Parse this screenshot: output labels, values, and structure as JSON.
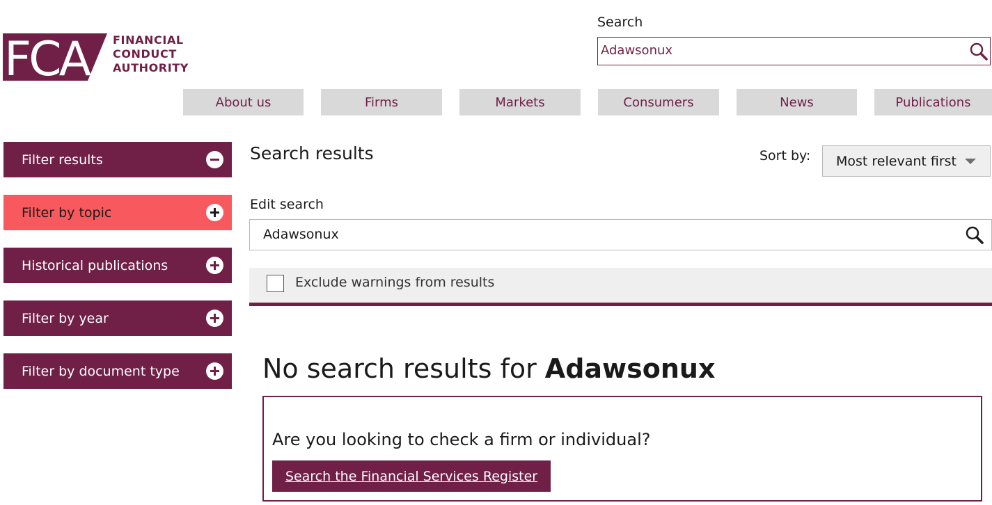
{
  "brand": {
    "logo_letters": "FCA",
    "logo_text_lines": [
      "FINANCIAL",
      "CONDUCT",
      "AUTHORITY"
    ],
    "color": "#701f46"
  },
  "header": {
    "search_label": "Search",
    "search_value": "Adawsonux",
    "search_icon": "search-icon"
  },
  "nav": {
    "items": [
      {
        "label": "About us"
      },
      {
        "label": "Firms"
      },
      {
        "label": "Markets"
      },
      {
        "label": "Consumers"
      },
      {
        "label": "News"
      },
      {
        "label": "Publications"
      }
    ]
  },
  "sidebar": {
    "items": [
      {
        "label": "Filter results",
        "state": "expanded",
        "icon": "minus-circle-icon"
      },
      {
        "label": "Filter by topic",
        "state": "collapsed",
        "icon": "plus-circle-icon",
        "active": true
      },
      {
        "label": "Historical publications",
        "state": "collapsed",
        "icon": "plus-circle-icon"
      },
      {
        "label": "Filter by year",
        "state": "collapsed",
        "icon": "plus-circle-icon"
      },
      {
        "label": "Filter by document type",
        "state": "collapsed",
        "icon": "plus-circle-icon"
      }
    ],
    "active_color": "#f8595e"
  },
  "main": {
    "title": "Search results",
    "sort_label": "Sort by:",
    "sort_value": "Most relevant first",
    "edit_label": "Edit search",
    "edit_value": "Adawsonux",
    "exclude_label": "Exclude warnings from results",
    "exclude_checked": false,
    "no_results_prefix": "No search results for ",
    "no_results_query": "Adawsonux",
    "register_question": "Are you looking to check a firm or individual?",
    "register_button": "Search the Financial Services Register"
  }
}
